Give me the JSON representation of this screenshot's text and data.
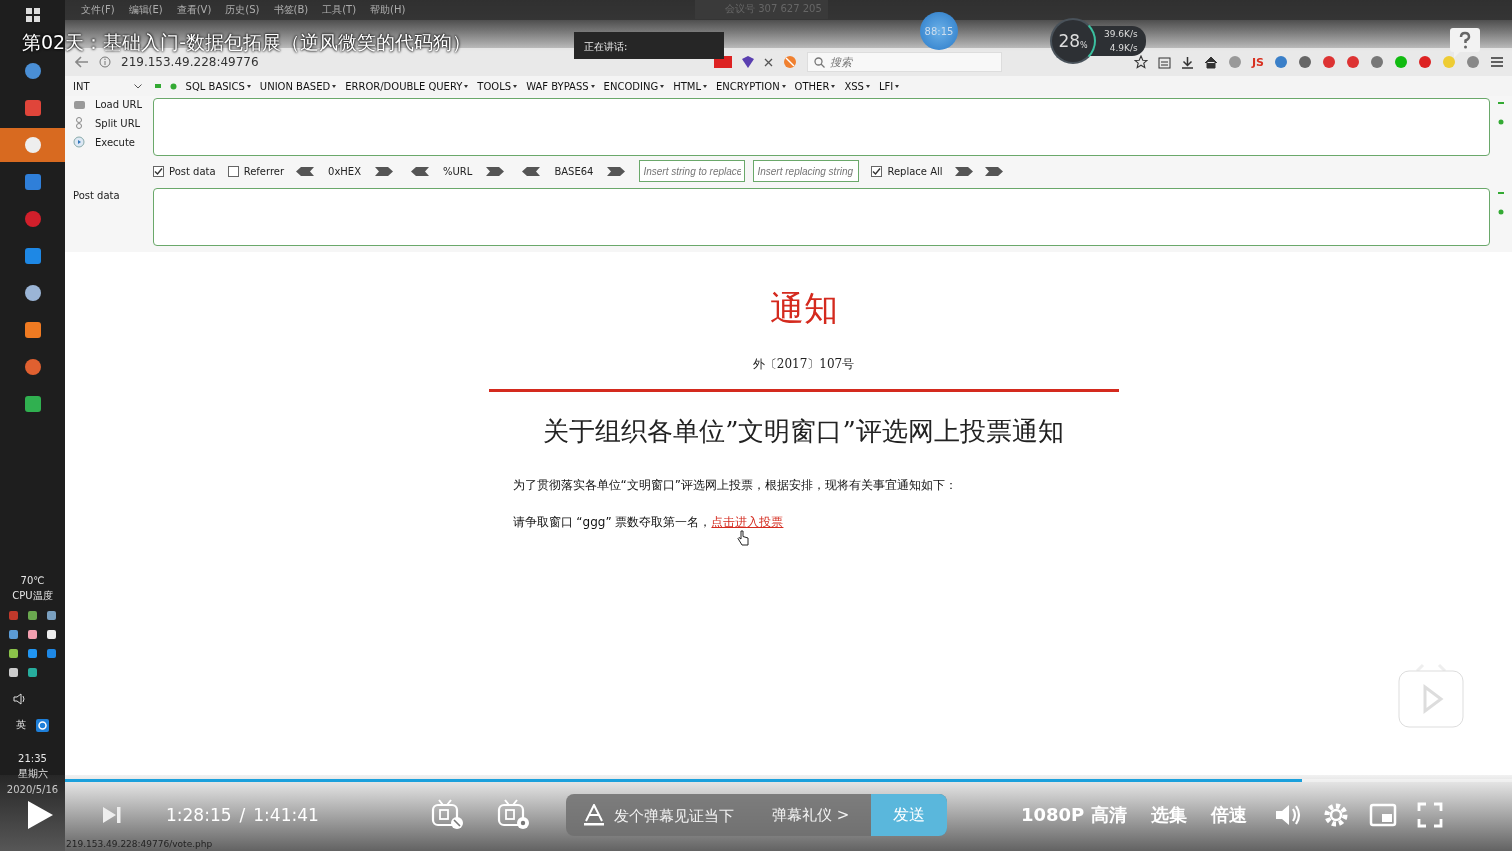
{
  "video_title": "第02天：基础入门-数据包拓展（逆风微笑的代码狗）",
  "menu": [
    "文件(F)",
    "编辑(E)",
    "查看(V)",
    "历史(S)",
    "书签(B)",
    "工具(T)",
    "帮助(H)"
  ],
  "meeting_badge": "会议号 307 627 205",
  "speaking_popup": "正在讲话:",
  "timer": "88:15",
  "net_widget": {
    "load": "28",
    "unit": "%",
    "upload": "39.6K/s",
    "download": "4.9K/s"
  },
  "browser": {
    "address": "219.153.49.228:49776",
    "search_placeholder": "搜索",
    "js_label": "JS"
  },
  "hackbar": {
    "select": "INT",
    "menus": [
      "SQL BASICS",
      "UNION BASED",
      "ERROR/DOUBLE QUERY",
      "TOOLS",
      "WAF BYPASS",
      "ENCODING",
      "HTML",
      "ENCRYPTION",
      "OTHER",
      "XSS",
      "LFI"
    ],
    "actions": [
      "Load URL",
      "Split URL",
      "Execute"
    ],
    "post_data": {
      "label": "Post data",
      "checked": true
    },
    "referrer": {
      "label": "Referrer",
      "checked": false
    },
    "encoders": [
      "0xHEX",
      "%URL",
      "BASE64"
    ],
    "replace_placeholder": "Insert string to replace",
    "replacing_placeholder": "Insert replacing string",
    "replace_all": {
      "label": "Replace All",
      "checked": true
    },
    "post_label": "Post data"
  },
  "document": {
    "heading": "通知",
    "number": "外〔2017〕107号",
    "title": "关于组织各单位”文明窗口”评选网上投票通知",
    "paragraph": "为了贯彻落实各单位“文明窗口”评选网上投票，根据安排，现将有关事宜通知如下：",
    "vote_text": "请争取窗口 “ggg” 票数夺取第一名，",
    "vote_link": "点击进入投票"
  },
  "taskbar": {
    "temperature": "70℃",
    "cpu_label": "CPU温度",
    "ime": "英",
    "time": "21:35",
    "weekday": "星期六",
    "date": "2020/5/16"
  },
  "player": {
    "level": 0.855,
    "current": "1:28:15",
    "separator": "/",
    "total": "1:41:41",
    "danmaku_placeholder": "发个弹幕见证当下",
    "etiquette": "弹幕礼仪 >",
    "send": "发送",
    "quality": "1080P 高清",
    "episodes": "选集",
    "speed": "倍速",
    "status_url": "219.153.49.228:49776/vote.php"
  }
}
